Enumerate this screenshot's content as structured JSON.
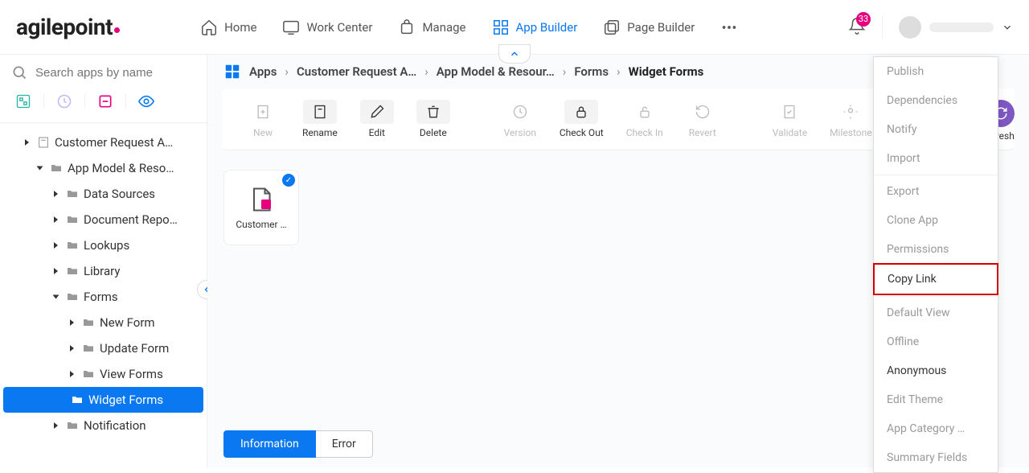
{
  "logo_text": "agilepoint",
  "nav": {
    "home": "Home",
    "work_center": "Work Center",
    "manage": "Manage",
    "app_builder": "App Builder",
    "page_builder": "Page Builder"
  },
  "notification_count": "33",
  "search_placeholder": "Search apps by name",
  "tree": {
    "root": "Customer Request A…",
    "model": "App Model & Reso…",
    "data_sources": "Data Sources",
    "doc_repo": "Document Repo…",
    "lookups": "Lookups",
    "library": "Library",
    "forms": "Forms",
    "new_form": "New Form",
    "update_form": "Update Form",
    "view_forms": "View Forms",
    "widget_forms": "Widget Forms",
    "notification": "Notification"
  },
  "breadcrumb": {
    "root": "Apps",
    "b1": "Customer Request A…",
    "b2": "App Model & Resour…",
    "b3": "Forms",
    "b4": "Widget Forms"
  },
  "toolbar": {
    "new": "New",
    "rename": "Rename",
    "edit": "Edit",
    "delete": "Delete",
    "version": "Version",
    "checkout": "Check Out",
    "checkin": "Check In",
    "revert": "Revert",
    "validate": "Validate",
    "milestone": "Milestone"
  },
  "refresh_label": "efresh",
  "card_label": "Customer …",
  "tabs": {
    "info": "Information",
    "error": "Error"
  },
  "menu": {
    "publish": "Publish",
    "dependencies": "Dependencies",
    "notify": "Notify",
    "import": "Import",
    "export": "Export",
    "clone": "Clone App",
    "permissions": "Permissions",
    "copy_link": "Copy Link",
    "default_view": "Default View",
    "offline": "Offline",
    "anonymous": "Anonymous",
    "edit_theme": "Edit Theme",
    "app_category": "App Category …",
    "summary_fields": "Summary Fields"
  }
}
